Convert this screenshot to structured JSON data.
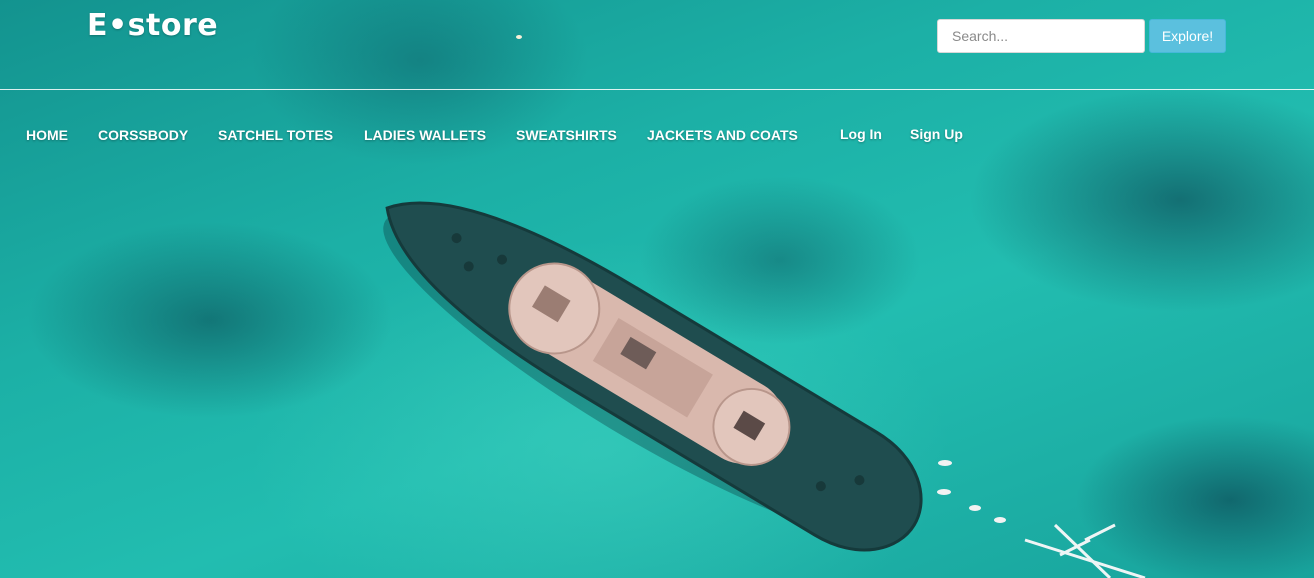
{
  "header": {
    "logo_text": "E•store",
    "search": {
      "placeholder": "Search...",
      "value": ""
    },
    "explore_label": "Explore!"
  },
  "nav": {
    "items": [
      {
        "label": "HOME"
      },
      {
        "label": "CORSSBODY"
      },
      {
        "label": "SATCHEL TOTES"
      },
      {
        "label": "LADIES WALLETS"
      },
      {
        "label": "SWEATSHIRTS"
      },
      {
        "label": "JACKETS AND COATS"
      }
    ],
    "auth": [
      {
        "label": "Log In"
      },
      {
        "label": "Sign Up"
      }
    ]
  },
  "colors": {
    "accent_button": "#5bc0de",
    "text_on_hero": "#ffffff",
    "sea": "#1fb3a6"
  }
}
